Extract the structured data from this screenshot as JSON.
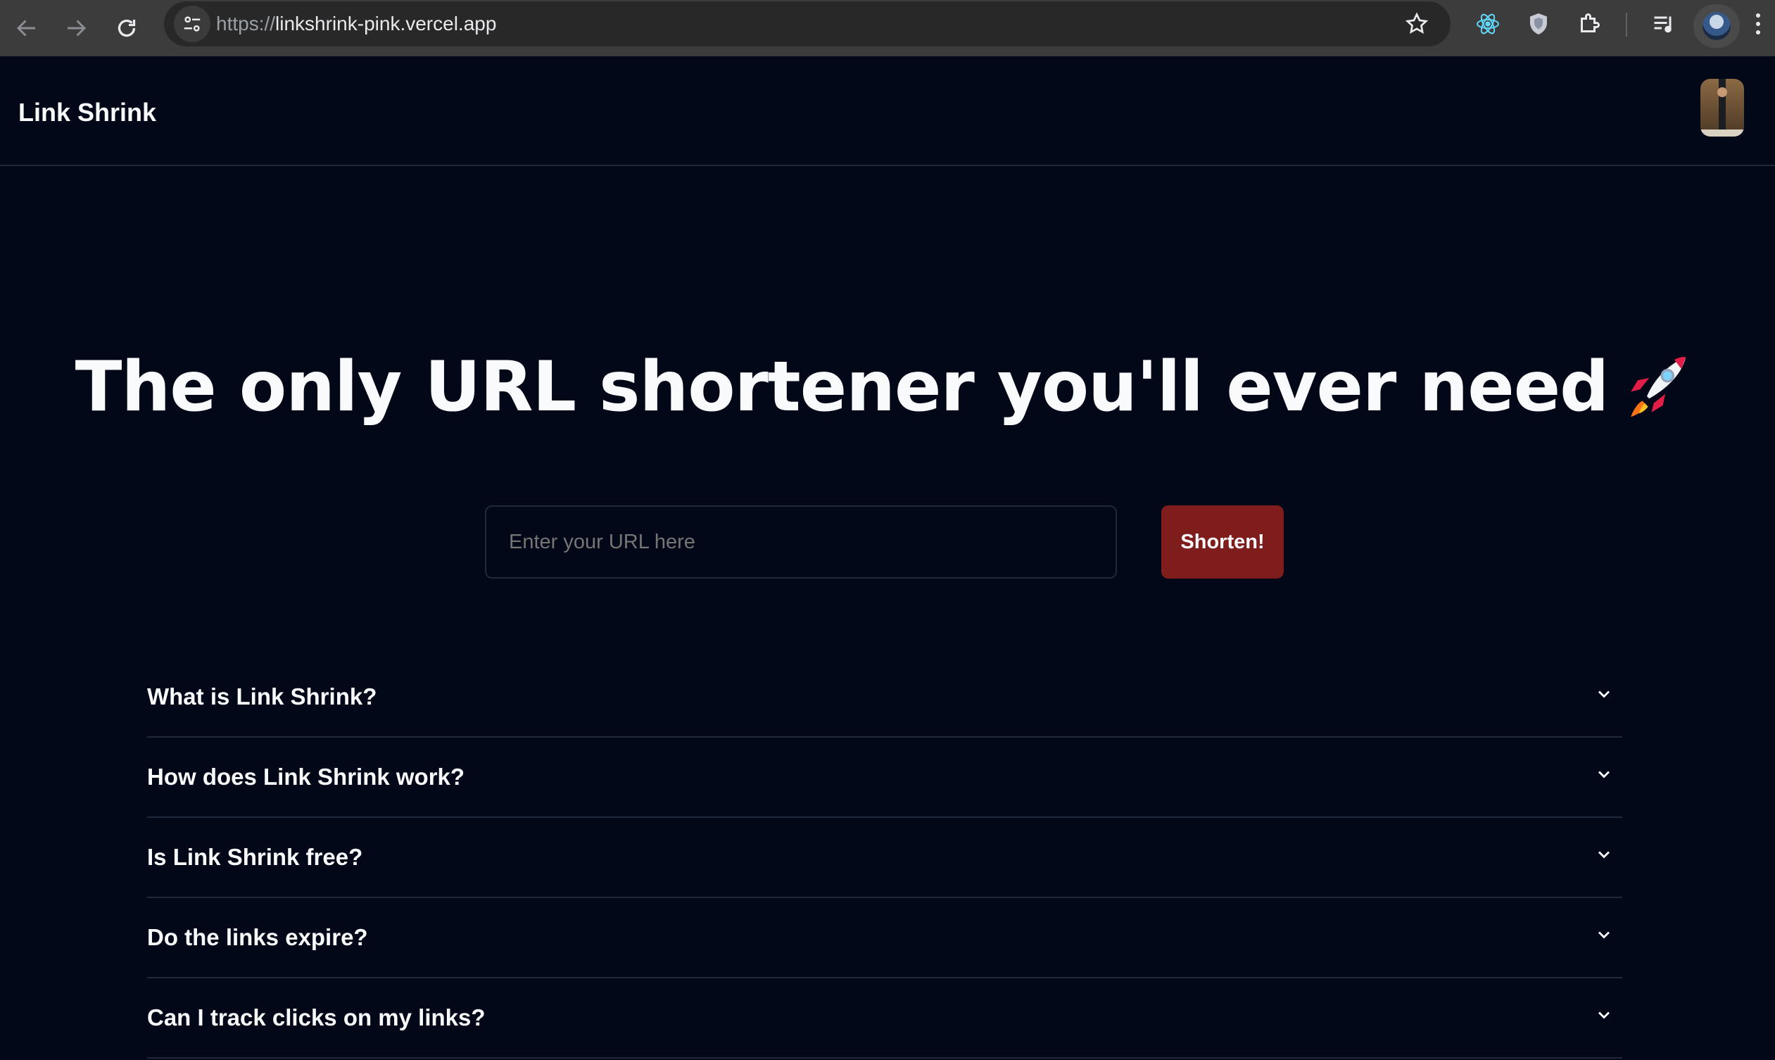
{
  "browser": {
    "url_scheme": "https://",
    "url_host": "linkshrink-pink.vercel.app"
  },
  "header": {
    "brand": "Link Shrink"
  },
  "hero": {
    "title": "The only URL shortener you'll ever need",
    "emoji_icon": "rocket-icon"
  },
  "form": {
    "url_placeholder": "Enter your URL here",
    "url_value": "",
    "submit_label": "Shorten!"
  },
  "faq": {
    "items": [
      {
        "question": "What is Link Shrink?"
      },
      {
        "question": "How does Link Shrink work?"
      },
      {
        "question": "Is Link Shrink free?"
      },
      {
        "question": "Do the links expire?"
      },
      {
        "question": "Can I track clicks on my links?"
      }
    ]
  },
  "colors": {
    "background": "#020817",
    "accent_button": "#7f1d1d",
    "border": "#1e293b",
    "text": "#f8fafc",
    "placeholder": "#94a3b8"
  }
}
